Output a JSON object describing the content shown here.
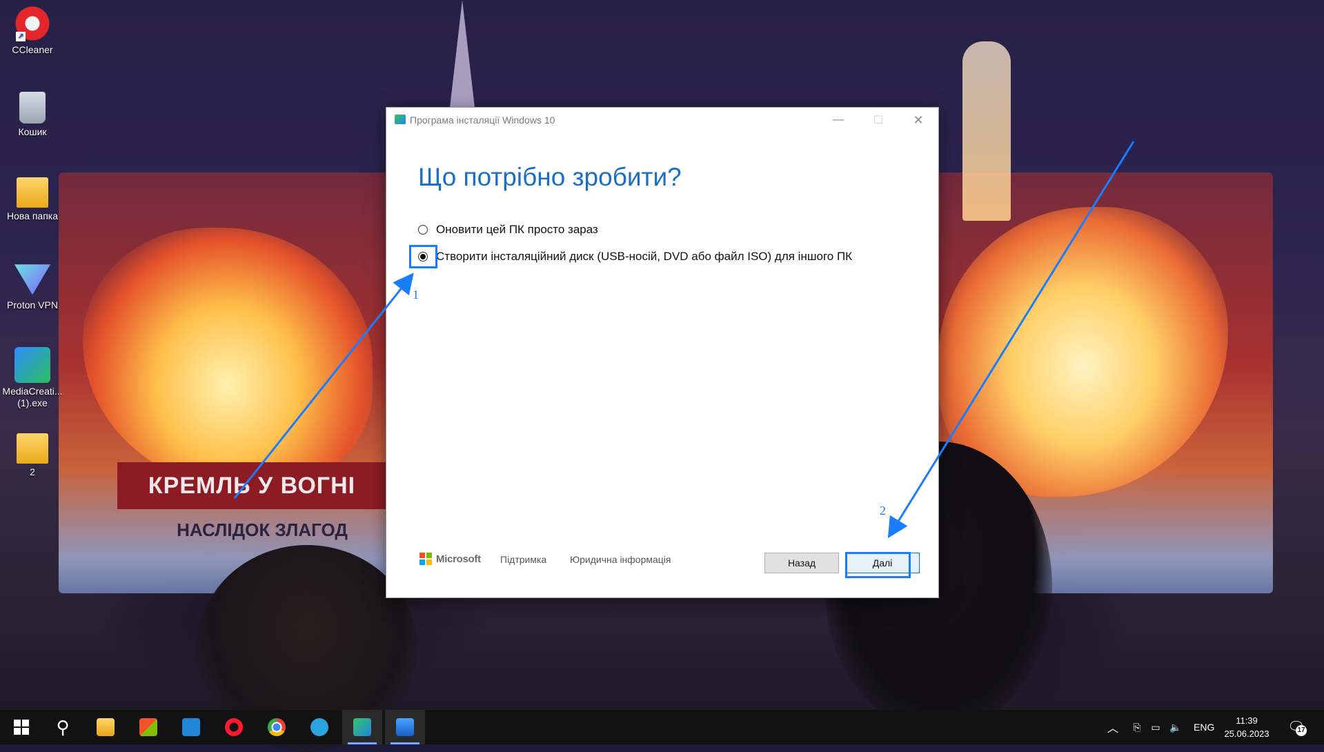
{
  "desktop": {
    "icons": [
      {
        "label": "CCleaner",
        "icon": "ccleaner-icon"
      },
      {
        "label": "Кошик",
        "icon": "recycle-bin-icon"
      },
      {
        "label": "Нова папка",
        "icon": "folder-icon"
      },
      {
        "label": "Proton VPN",
        "icon": "proton-vpn-icon"
      },
      {
        "label": "MediaCreati... (1).exe",
        "icon": "media-creation-tool-icon"
      },
      {
        "label": "2",
        "icon": "folder-icon"
      }
    ]
  },
  "wallpaper": {
    "banner": "КРЕМЛЬ У ВОГНІ",
    "subbanner": "НАСЛІДОК ЗЛАГОД"
  },
  "dialog": {
    "title": "Програма інсталяції Windows 10",
    "heading": "Що потрібно зробити?",
    "options": [
      {
        "label": "Оновити цей ПК просто зараз",
        "selected": false
      },
      {
        "label": "Створити інсталяційний диск (USB-носій, DVD або файл ISO) для іншого ПК",
        "selected": true
      }
    ],
    "brand": "Microsoft",
    "links": {
      "support": "Підтримка",
      "legal": "Юридична інформація"
    },
    "buttons": {
      "back": "Назад",
      "next": "Далі"
    }
  },
  "annotations": {
    "step1": "1",
    "step2": "2",
    "color": "#1a7cff"
  },
  "taskbar": {
    "apps": [
      "start",
      "search",
      "file-explorer",
      "microsoft-store",
      "mail",
      "opera",
      "chrome",
      "telegram",
      "windows-setup",
      "photos"
    ],
    "tray": {
      "language": "ENG",
      "time": "11:39",
      "date": "25.06.2023",
      "notifications": "17"
    }
  },
  "colors": {
    "accent": "#1a6fc4",
    "taskbar": "#121212"
  }
}
